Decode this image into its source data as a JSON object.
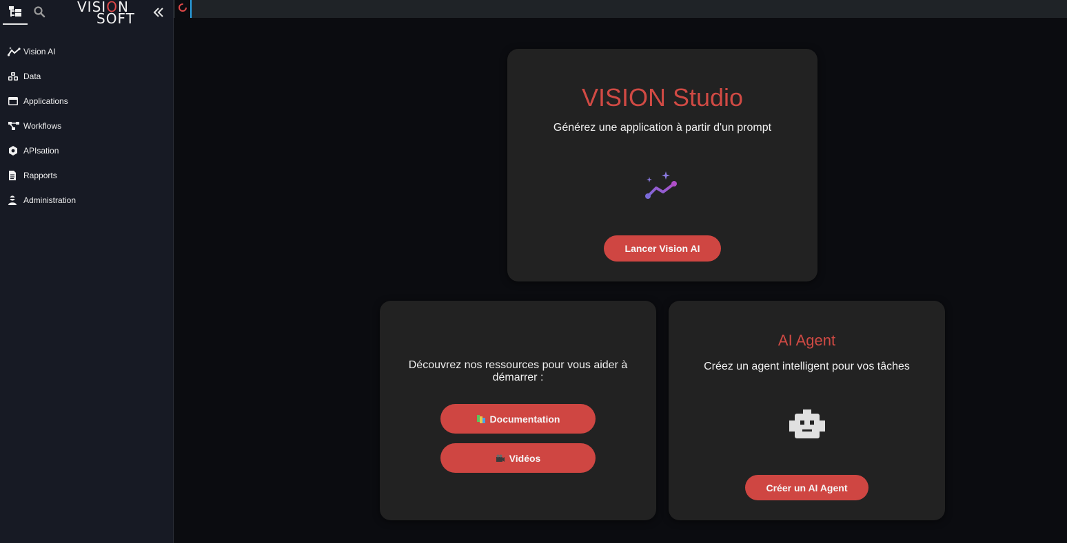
{
  "logo": {
    "line1_a": "VISI",
    "line1_o": "O",
    "line1_b": "N",
    "line2": "SOFT"
  },
  "sidebar": {
    "items": [
      {
        "label": "Vision AI",
        "icon": "sparkle-chart-icon"
      },
      {
        "label": "Data",
        "icon": "cubes-icon"
      },
      {
        "label": "Applications",
        "icon": "window-icon"
      },
      {
        "label": "Workflows",
        "icon": "workflow-icon"
      },
      {
        "label": "APIsation",
        "icon": "cog-hex-icon"
      },
      {
        "label": "Rapports",
        "icon": "document-icon"
      },
      {
        "label": "Administration",
        "icon": "user-admin-icon"
      }
    ]
  },
  "studio": {
    "title": "VISION Studio",
    "subtitle": "Générez une application à partir d'un prompt",
    "button": "Lancer Vision AI"
  },
  "resources": {
    "text": "Découvrez nos ressources pour vous aider à démarrer :",
    "doc_button": "Documentation",
    "video_button": "Vidéos"
  },
  "agent": {
    "title": "AI Agent",
    "subtitle": "Créez un agent intelligent pour vos tâches",
    "button": "Créer un AI Agent"
  },
  "colors": {
    "accent": "#cf4642",
    "sidebar_bg": "#171a24",
    "card_bg": "#222222",
    "page_bg": "#0b0c10",
    "tab_indicator": "#2aa3e6"
  }
}
